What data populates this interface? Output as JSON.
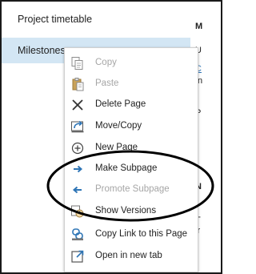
{
  "pages": [
    {
      "label": "Project timetable"
    },
    {
      "label": "Milestones"
    }
  ],
  "content_fragments": [
    "M",
    "U",
    "C",
    "In",
    "P",
    "N",
    "T",
    "ir"
  ],
  "menu": {
    "items": [
      {
        "label": "Copy",
        "icon": "copy-icon",
        "disabled": true
      },
      {
        "label": "Paste",
        "icon": "paste-icon",
        "disabled": true
      },
      {
        "label": "Delete Page",
        "icon": "delete-x-icon",
        "disabled": false
      },
      {
        "label": "Move/Copy",
        "icon": "move-copy-icon",
        "disabled": false
      },
      {
        "label": "New Page",
        "icon": "new-page-plus-icon",
        "disabled": false
      },
      {
        "label": "Make Subpage",
        "icon": "arrow-right-icon",
        "disabled": false
      },
      {
        "label": "Promote Subpage",
        "icon": "arrow-left-icon",
        "disabled": true
      },
      {
        "label": "Show Versions",
        "icon": "versions-icon",
        "disabled": false
      },
      {
        "label": "Copy Link to this Page",
        "icon": "link-icon",
        "disabled": false
      },
      {
        "label": "Open in new tab",
        "icon": "open-new-tab-icon",
        "disabled": false
      }
    ]
  },
  "colors": {
    "selection": "#d3e6f4",
    "accent_blue": "#2e75b6",
    "disabled_text": "#a6a6a6",
    "annotation_ellipse": "#000000"
  }
}
